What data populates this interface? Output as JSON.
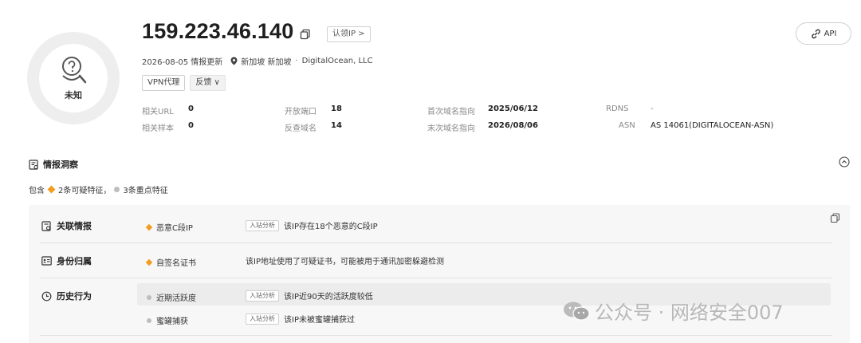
{
  "header": {
    "ip": "159.223.46.140",
    "claim_label": "认领IP >",
    "risk_level": "未知",
    "update_date": "2026-08-05 情报更新",
    "location": "新加坡 新加坡",
    "separator": "·",
    "org": "DigitalOcean, LLC",
    "tags": [
      "VPN代理",
      "反馈 ∨"
    ],
    "api_label": "API"
  },
  "stats": [
    {
      "key": "相关URL",
      "value": "0"
    },
    {
      "key": "开放端口",
      "value": "18"
    },
    {
      "key": "首次域名指向",
      "value": "2025/06/12"
    },
    {
      "key": "RDNS",
      "value": "-"
    },
    {
      "key": "相关样本",
      "value": "0"
    },
    {
      "key": "反查域名",
      "value": "14"
    },
    {
      "key": "末次域名指向",
      "value": "2026/08/06"
    },
    {
      "key": "ASN",
      "value": "AS 14061(DIGITALOCEAN-ASN)"
    }
  ],
  "insight": {
    "title": "情报洞察",
    "summary_prefix": "包含",
    "summary_suspicious": "2条可疑特征，",
    "summary_key": "3条重点特征",
    "rows": [
      {
        "category": "关联情报",
        "feature": "恶意C段IP",
        "tag": "入站分析",
        "desc": "该IP存在18个恶意的C段IP"
      },
      {
        "category": "身份归属",
        "feature": "自签名证书",
        "tag": "",
        "desc": "该IP地址使用了可疑证书，可能被用于通讯加密躲避检测"
      },
      {
        "category": "历史行为",
        "feature": "近期活跃度",
        "tag": "入站分析",
        "desc": "该IP近90天的活跃度较低"
      },
      {
        "category": "",
        "feature": "蜜罐捕获",
        "tag": "入站分析",
        "desc": "该IP未被蜜罐捕获过"
      }
    ]
  },
  "watermark": "公众号 · 网络安全007"
}
